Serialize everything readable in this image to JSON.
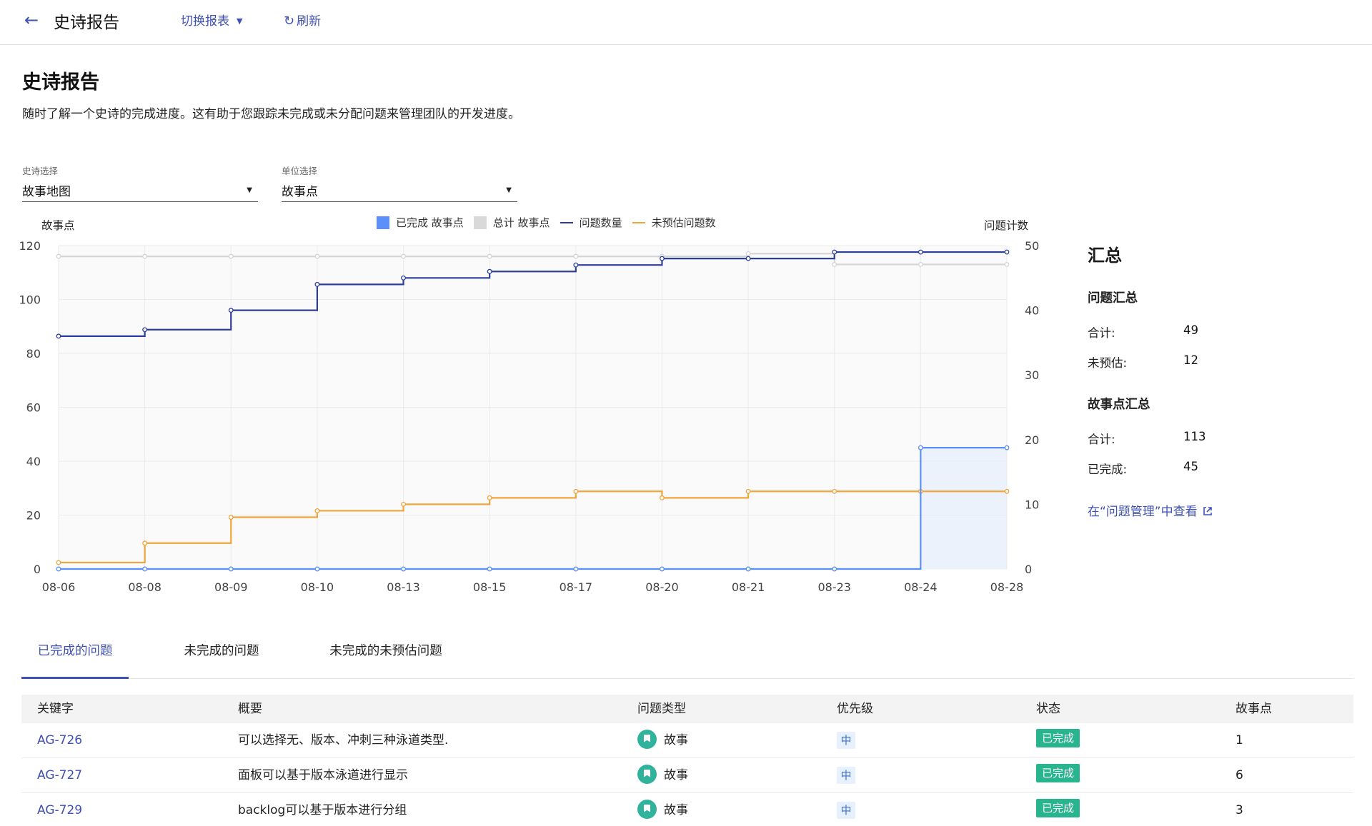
{
  "topbar": {
    "title": "史诗报告",
    "switch_label": "切换报表",
    "refresh_label": "刷新"
  },
  "page": {
    "heading": "史诗报告",
    "description": "随时了解一个史诗的完成进度。这有助于您跟踪未完成或未分配问题来管理团队的开发进度。"
  },
  "filters": {
    "epic": {
      "label": "史诗选择",
      "value": "故事地图"
    },
    "unit": {
      "label": "单位选择",
      "value": "故事点"
    }
  },
  "chart_data": {
    "type": "line",
    "ylabel_left": "故事点",
    "ylabel_right": "问题计数",
    "ylim_left": [
      0,
      120
    ],
    "ylim_right": [
      0,
      50
    ],
    "yticks_left": [
      "0",
      "20",
      "40",
      "60",
      "80",
      "100",
      "120"
    ],
    "yticks_right": [
      "0",
      "10",
      "20",
      "30",
      "40",
      "50"
    ],
    "categories": [
      "08-06",
      "08-08",
      "08-09",
      "08-10",
      "08-13",
      "08-15",
      "08-17",
      "08-20",
      "08-21",
      "08-23",
      "08-24",
      "08-28"
    ],
    "legend": [
      {
        "name": "已完成 故事点",
        "color": "#5b8ff9",
        "kind": "box"
      },
      {
        "name": "总计 故事点",
        "color": "#d9d9d9",
        "kind": "box"
      },
      {
        "name": "问题数量",
        "color": "#2c3e9c",
        "kind": "line"
      },
      {
        "name": "未预估问题数",
        "color": "#f0a43a",
        "kind": "line"
      }
    ],
    "series": [
      {
        "name": "已完成 故事点",
        "axis": "left",
        "color": "#5b8ff9",
        "values": [
          0,
          0,
          0,
          0,
          0,
          0,
          0,
          0,
          0,
          0,
          45,
          45
        ]
      },
      {
        "name": "总计 故事点",
        "axis": "left",
        "color": "#d4d4d4",
        "values": [
          116,
          116,
          116,
          116,
          116,
          116,
          116,
          116,
          117,
          113,
          113,
          113
        ]
      },
      {
        "name": "问题数量",
        "axis": "right",
        "color": "#2c3e9c",
        "values": [
          36,
          37,
          40,
          44,
          45,
          46,
          47,
          48,
          48,
          49,
          49,
          49
        ]
      },
      {
        "name": "未预估问题数",
        "axis": "right",
        "color": "#f0a43a",
        "values": [
          1,
          4,
          8,
          9,
          10,
          11,
          12,
          11,
          12,
          12,
          12,
          12
        ]
      }
    ]
  },
  "summary": {
    "title": "汇总",
    "issue_heading": "问题汇总",
    "issue_total_label": "合计:",
    "issue_total": "49",
    "issue_unestimated_label": "未预估:",
    "issue_unestimated": "12",
    "points_heading": "故事点汇总",
    "points_total_label": "合计:",
    "points_total": "113",
    "points_done_label": "已完成:",
    "points_done": "45",
    "link": "在“问题管理”中查看"
  },
  "tabs": [
    "已完成的问题",
    "未完成的问题",
    "未完成的未预估问题"
  ],
  "table": {
    "columns": [
      "关键字",
      "概要",
      "问题类型",
      "优先级",
      "状态",
      "故事点"
    ],
    "rows": [
      {
        "key": "AG-726",
        "summary": "可以选择无、版本、冲刺三种泳道类型.",
        "type": "故事",
        "priority": "中",
        "status": "已完成",
        "points": "1"
      },
      {
        "key": "AG-727",
        "summary": "面板可以基于版本泳道进行显示",
        "type": "故事",
        "priority": "中",
        "status": "已完成",
        "points": "6"
      },
      {
        "key": "AG-729",
        "summary": "backlog可以基于版本进行分组",
        "type": "故事",
        "priority": "中",
        "status": "已完成",
        "points": "3"
      }
    ]
  }
}
